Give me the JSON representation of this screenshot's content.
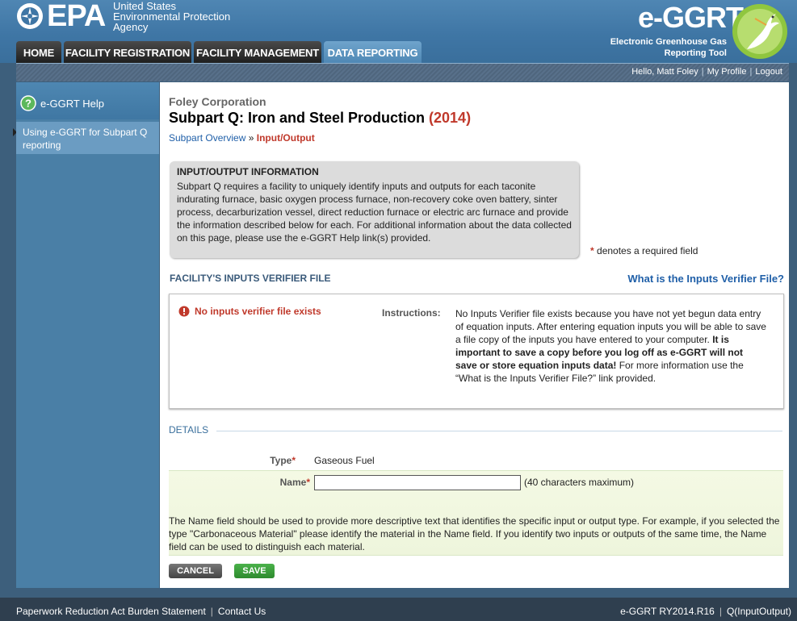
{
  "header": {
    "epa_word": "EPA",
    "agency_lines": [
      "United States",
      "Environmental Protection",
      "Agency"
    ],
    "app_title": "e-GGRT",
    "app_subtitle_lines": [
      "Electronic Greenhouse Gas",
      "Reporting Tool"
    ]
  },
  "nav": {
    "tabs": [
      {
        "label": "HOME",
        "active": false
      },
      {
        "label": "FACILITY REGISTRATION",
        "active": false
      },
      {
        "label": "FACILITY MANAGEMENT",
        "active": false
      },
      {
        "label": "DATA REPORTING",
        "active": true
      }
    ]
  },
  "userbar": {
    "greeting": "Hello, Matt Foley",
    "profile": "My Profile",
    "logout": "Logout"
  },
  "sidebar": {
    "help_title": "e-GGRT Help",
    "help_link": "Using e-GGRT for Subpart Q reporting"
  },
  "main": {
    "company": "Foley Corporation",
    "title": "Subpart Q: Iron and Steel Production",
    "year": "(2014)",
    "breadcrumb_overview": "Subpart Overview",
    "breadcrumb_sep": "»",
    "breadcrumb_current": "Input/Output",
    "info_title": "INPUT/OUTPUT INFORMATION",
    "info_text": "Subpart Q requires a facility to uniquely identify inputs and outputs for each taconite indurating furnace, basic oxygen process furnace, non-recovery coke oven battery, sinter process, decarburization vessel, direct reduction furnace or electric arc furnace and provide the information described below for each. For additional information about the data collected on this page, please use the e-GGRT Help link(s) provided.",
    "required_star": "*",
    "required_note": "denotes a required field",
    "verifier_heading": "FACILITY'S INPUTS VERIFIER FILE",
    "verifier_link": "What is the Inputs Verifier File?",
    "verifier_error": "No inputs verifier file exists",
    "instructions_label": "Instructions:",
    "instructions_part1": "No Inputs Verifier file exists because you have not yet begun data entry of equation inputs.  After entering equation inputs you will be able to save a file copy of the inputs you have entered to your computer. ",
    "instructions_bold": "It is important to save a copy before you log off as e-GGRT will not save or store equation inputs data!",
    "instructions_part2": " For more information use the “What is the Inputs Verifier File?” link provided.",
    "details_label": "DETAILS",
    "type_label": "Type",
    "type_value": "Gaseous Fuel",
    "name_label": "Name",
    "name_value": "",
    "name_hint": "(40 characters maximum)",
    "name_help": "The Name field should be used to provide more descriptive text that identifies the specific input or output type. For example, if you selected the type \"Carbonaceous Material\" please identify the material in the Name field. If you identify two inputs or outputs of the same time, the Name field can be used to distinguish each material.",
    "cancel_label": "CANCEL",
    "save_label": "SAVE"
  },
  "footer": {
    "paperwork": "Paperwork Reduction Act Burden Statement",
    "contact": "Contact Us",
    "version": "e-GGRT RY2014.R16",
    "page_code": "Q(InputOutput)"
  },
  "colors": {
    "accent": "#3f76a5",
    "error": "#c0392b",
    "save": "#2e8b2e"
  }
}
